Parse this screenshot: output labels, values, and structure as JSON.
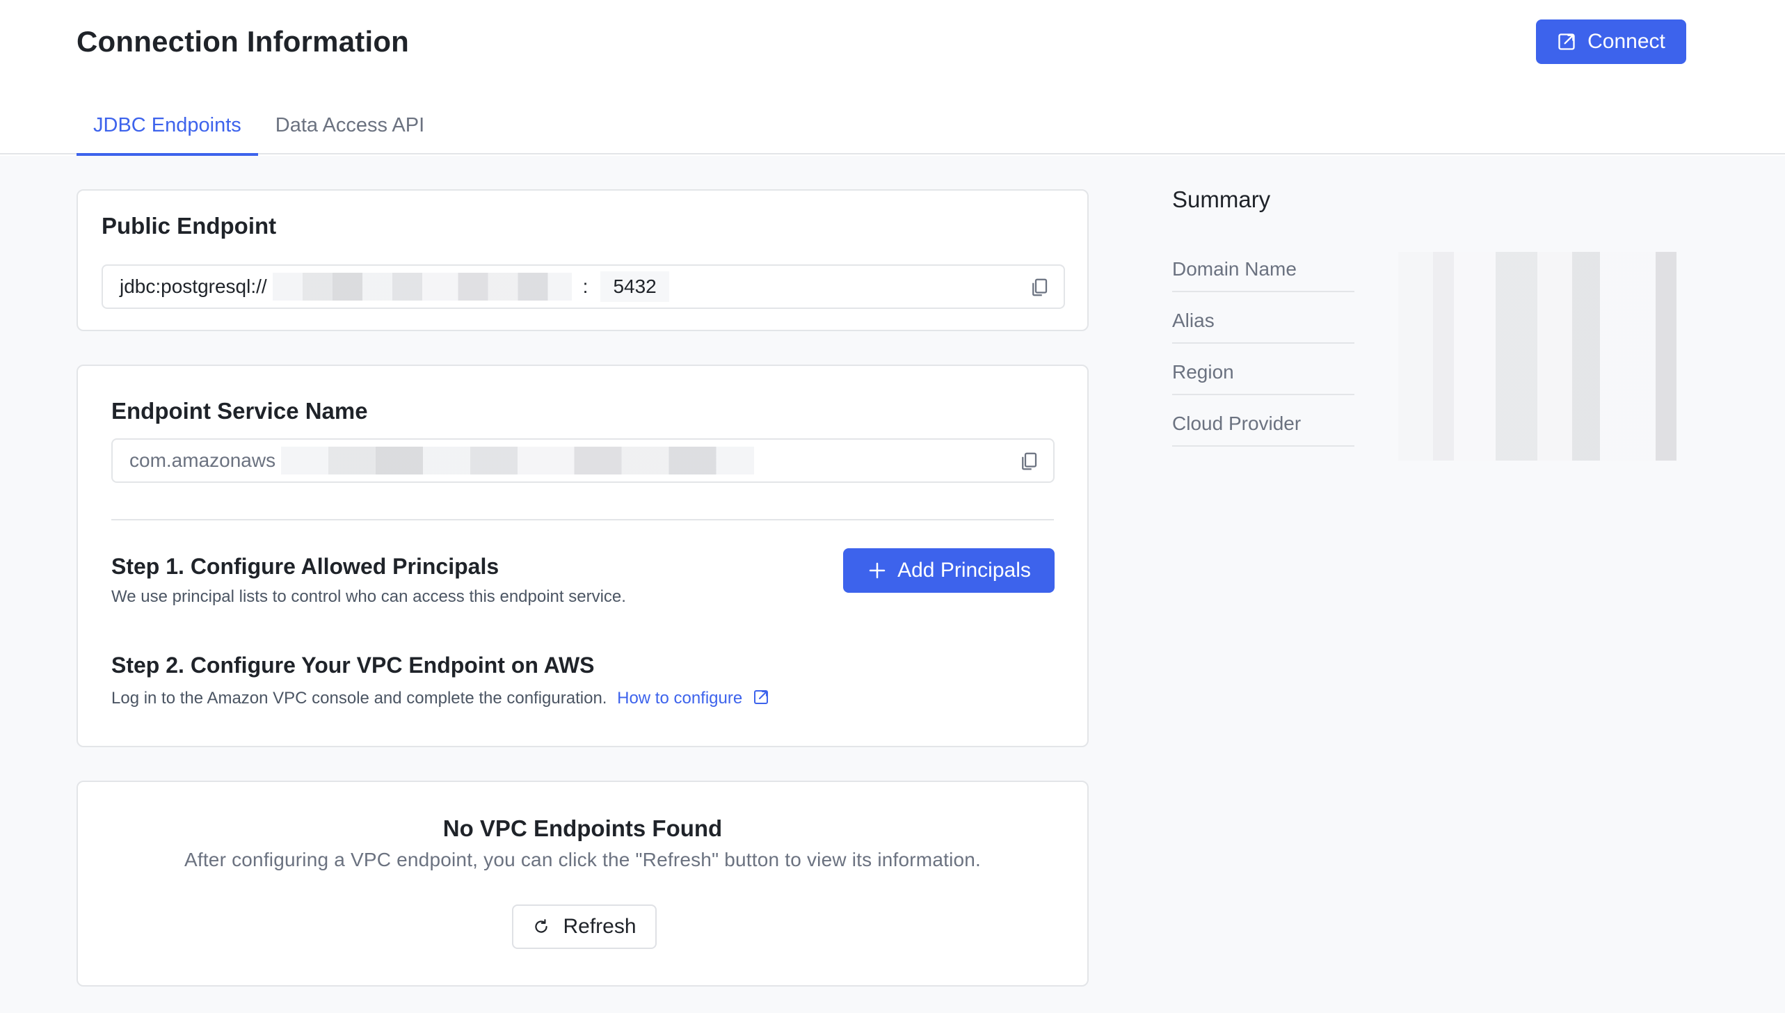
{
  "header": {
    "title": "Connection Information",
    "connect_label": "Connect"
  },
  "tabs": [
    {
      "label": "JDBC Endpoints",
      "active": true
    },
    {
      "label": "Data Access API",
      "active": false
    }
  ],
  "public_endpoint": {
    "title": "Public Endpoint",
    "prefix": "jdbc:postgresql://",
    "separator": ":",
    "port": "5432"
  },
  "endpoint_service": {
    "title": "Endpoint Service Name",
    "value_prefix": "com.amazonaws",
    "step1": {
      "title": "Step 1. Configure Allowed Principals",
      "desc": "We use principal lists to control who can access this endpoint service.",
      "button_label": "Add Principals"
    },
    "step2": {
      "title": "Step 2. Configure Your VPC Endpoint on AWS",
      "desc": "Log in to the Amazon VPC console and complete the configuration.",
      "link_label": "How to configure"
    }
  },
  "vpc": {
    "title": "No VPC Endpoints Found",
    "desc": "After configuring a VPC endpoint, you can click the \"Refresh\" button to view its information.",
    "refresh_label": "Refresh"
  },
  "summary": {
    "title": "Summary",
    "rows": [
      {
        "label": "Domain Name"
      },
      {
        "label": "Alias"
      },
      {
        "label": "Region"
      },
      {
        "label": "Cloud Provider"
      }
    ]
  },
  "colors": {
    "accent": "#3d63ec",
    "border": "#e3e5e8",
    "background": "#f8f9fb"
  }
}
